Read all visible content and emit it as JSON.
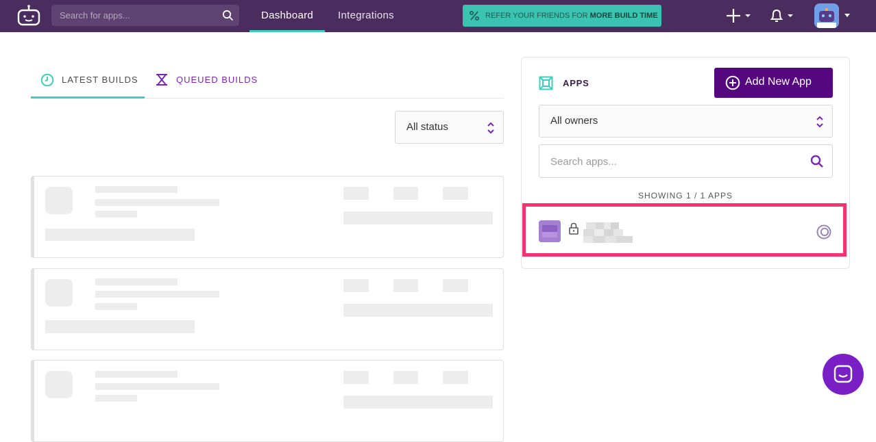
{
  "topbar": {
    "search_placeholder": "Search for apps...",
    "nav": [
      {
        "label": "Dashboard",
        "active": true
      },
      {
        "label": "Integrations",
        "active": false
      }
    ],
    "referral": {
      "prefix": "REFER YOUR FRIENDS FOR",
      "highlight": "MORE BUILD TIME"
    },
    "icons": [
      "bitrise-logo-icon",
      "search-icon",
      "plus-icon",
      "bell-icon",
      "avatar",
      "chevron-down-icon"
    ]
  },
  "builds": {
    "tabs": [
      {
        "label": "LATEST BUILDS",
        "active": true,
        "icon": "clock-icon"
      },
      {
        "label": "QUEUED BUILDS",
        "active": false,
        "icon": "hourglass-icon"
      }
    ],
    "status_filter": {
      "selected": "All status"
    },
    "cards_loading": 3
  },
  "apps": {
    "title": "APPS",
    "add_button": "Add New App",
    "owner_filter": {
      "selected": "All owners"
    },
    "search_placeholder": "Search apps...",
    "showing": "SHOWING 1 / 1 APPS",
    "list": [
      {
        "name_redacted": true,
        "private": true
      }
    ]
  },
  "colors": {
    "topbar": "#4b2c5e",
    "accent_teal": "#3dcdc1",
    "brand_purple": "#55077f",
    "queued_purple": "#7b25b8",
    "highlight": "#f5336f"
  }
}
